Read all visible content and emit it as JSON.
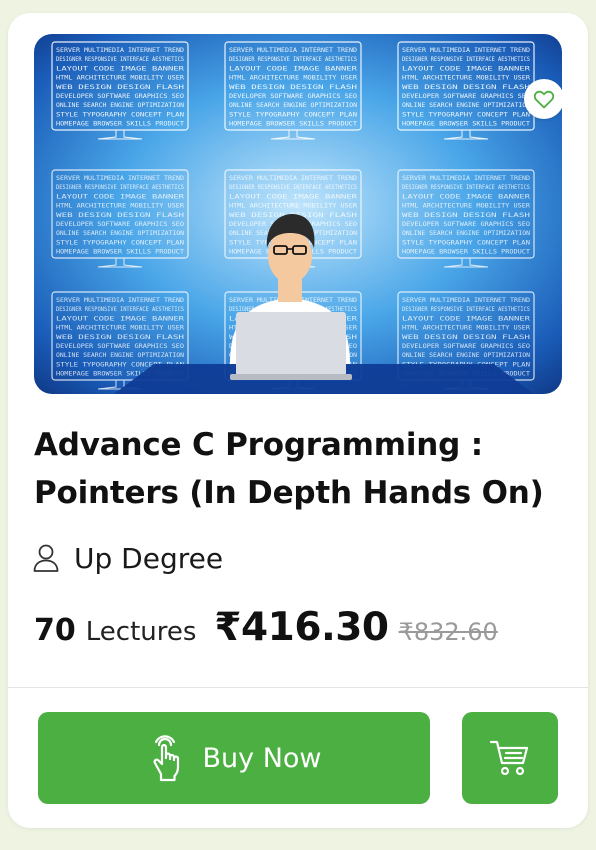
{
  "course": {
    "title_line1": "Advance C Programming :",
    "title_line2": "Pointers (In Depth Hands On)",
    "author": "Up Degree",
    "lectures_count": "70",
    "lectures_label": "Lectures",
    "price": "₹416.30",
    "original_price": "₹832.60",
    "thumbnail_words": "SERVER MULTIMEDIA INTERNET TREND DESIGNER RESPONSIVE INTERFACE AESTHETICS LAYOUT CODE IMAGE BANNER HTML ARCHITECTURE MOBILITY USER WEB DESIGN DESIGN FLASH DEVELOPER SOFTWARE GRAPHICS SEO ONLINE SEARCH ENGINE OPTIMIZATION STYLE TYPOGRAPHY CONCEPT PLAN HOMEPAGE BROWSER SKILLS PRODUCT PROFESSIONAL"
  },
  "actions": {
    "buy_label": "Buy Now"
  },
  "icons": {
    "favorite": "heart-icon",
    "author": "user-icon",
    "buy": "hand-pointer-icon",
    "cart": "cart-icon"
  },
  "colors": {
    "accent": "#4caf42",
    "background": "#eef3e2",
    "card": "#ffffff",
    "thumbnail_blue": "#2a7fd4"
  }
}
